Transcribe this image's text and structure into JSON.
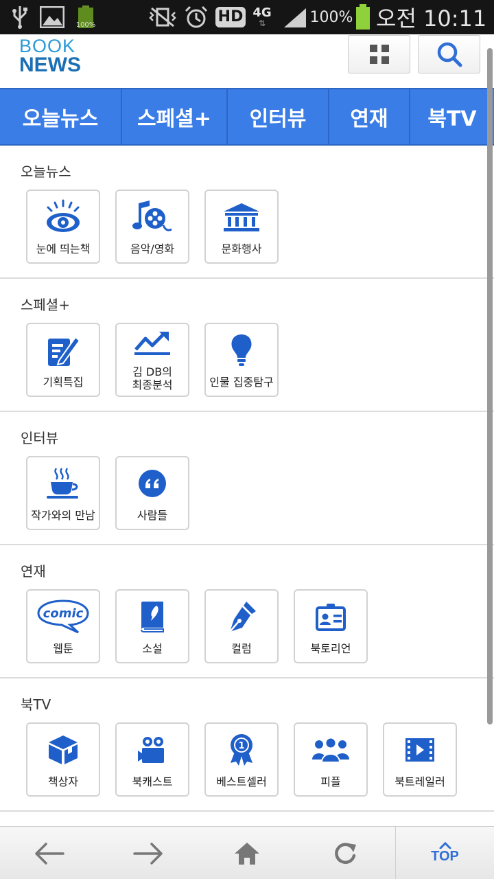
{
  "status_bar": {
    "battery_small_pct": "100%",
    "network": "4G",
    "hd": "HD",
    "battery_pct": "100%",
    "time": "오전 10:11"
  },
  "header": {
    "logo_line1": "BOOK",
    "logo_line2": "NEWS",
    "menu_icon": "grid-icon",
    "search_icon": "search-icon"
  },
  "nav": {
    "tabs": [
      {
        "label": "오늘뉴스"
      },
      {
        "label": "스페셜+"
      },
      {
        "label": "인터뷰"
      },
      {
        "label": "연재"
      },
      {
        "label": "북TV"
      }
    ]
  },
  "sections": [
    {
      "title": "오늘뉴스",
      "items": [
        {
          "label": "눈에 띄는책",
          "icon": "eye-icon"
        },
        {
          "label": "음악/영화",
          "icon": "music-film-icon"
        },
        {
          "label": "문화행사",
          "icon": "museum-icon"
        }
      ]
    },
    {
      "title": "스페셜+",
      "items": [
        {
          "label": "기획특집",
          "icon": "edit-document-icon"
        },
        {
          "label": "김 DB의\n최종분석",
          "icon": "trend-chart-icon"
        },
        {
          "label": "인물 집중탐구",
          "icon": "lightbulb-icon"
        }
      ]
    },
    {
      "title": "인터뷰",
      "items": [
        {
          "label": "작가와의 만남",
          "icon": "coffee-cup-icon"
        },
        {
          "label": "사람들",
          "icon": "quote-icon"
        }
      ]
    },
    {
      "title": "연재",
      "items": [
        {
          "label": "웹툰",
          "icon": "comic-bubble-icon"
        },
        {
          "label": "소설",
          "icon": "book-feather-icon"
        },
        {
          "label": "컬럼",
          "icon": "pen-icon"
        },
        {
          "label": "북토리언",
          "icon": "id-card-icon"
        }
      ]
    },
    {
      "title": "북TV",
      "items": [
        {
          "label": "책상자",
          "icon": "box-icon"
        },
        {
          "label": "북캐스트",
          "icon": "video-camera-icon"
        },
        {
          "label": "베스트셀러",
          "icon": "award-ribbon-icon"
        },
        {
          "label": "피플",
          "icon": "people-icon"
        },
        {
          "label": "북트레일러",
          "icon": "film-play-icon"
        }
      ]
    }
  ],
  "comic_word": "comic",
  "award_number": "1",
  "bottom_bar": {
    "back_icon": "back-arrow-icon",
    "forward_icon": "forward-arrow-icon",
    "home_icon": "home-icon",
    "refresh_icon": "refresh-icon",
    "top_label": "TOP"
  },
  "colors": {
    "accent": "#3b7de6",
    "icon_blue": "#1f5fc9",
    "logo_light": "#2a9bd8",
    "logo_dark": "#1b6fb5"
  }
}
